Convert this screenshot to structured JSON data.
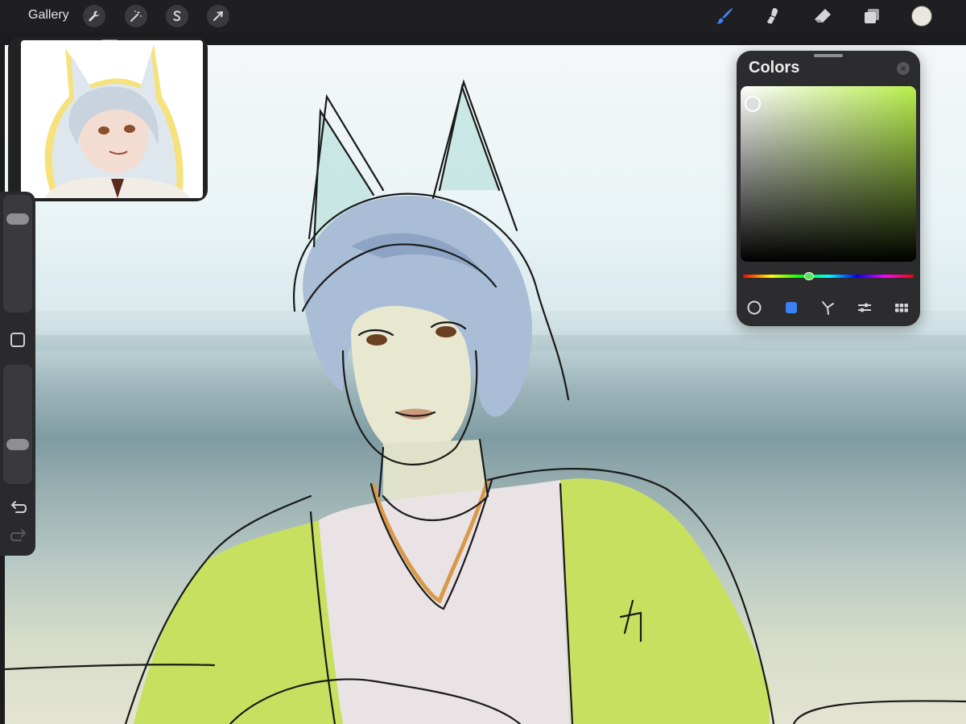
{
  "toolbar": {
    "gallery_label": "Gallery",
    "left_tools": [
      "wrench-icon",
      "magic-wand-icon",
      "selection-s-icon",
      "transform-arrow-icon"
    ],
    "right_tools": [
      "brush-icon",
      "smudge-icon",
      "eraser-icon",
      "layers-icon"
    ],
    "current_color": "#e8e8e0",
    "active_tool_color": "#3b82f6"
  },
  "colors_panel": {
    "title": "Colors",
    "selected_hue_color": "#b7f04c",
    "current_color": "#dedede",
    "hue_position_fraction": 0.38,
    "modes": [
      "disc-mode-icon",
      "classic-mode-icon",
      "harmony-mode-icon",
      "value-mode-icon",
      "palettes-mode-icon"
    ],
    "active_mode_index": 1
  },
  "sidebar": {
    "brush_size_level": 0.85,
    "brush_opacity_level": 0.3
  },
  "canvas": {
    "background_top_color": "#f4f7f8",
    "background_mid_color": "#7f9ca3",
    "jacket_color": "#c8e060",
    "hair_color": "#a9bdd6"
  }
}
